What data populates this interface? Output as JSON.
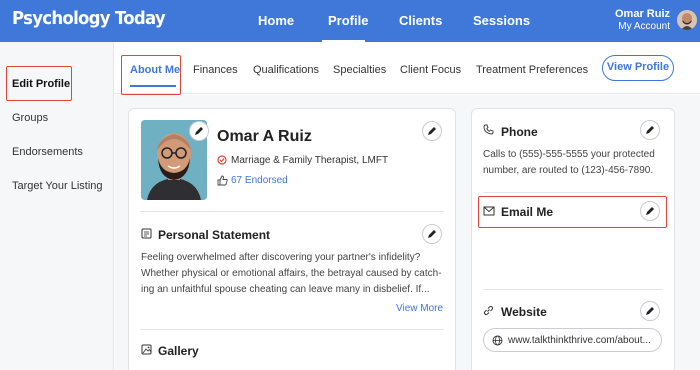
{
  "header": {
    "logo": "Psychology Today",
    "nav": [
      "Home",
      "Profile",
      "Clients",
      "Sessions"
    ],
    "active_nav": "Profile",
    "user_name": "Omar Ruiz",
    "account_label": "My Account"
  },
  "sidebar": {
    "items": [
      {
        "label": "Edit Profile",
        "active": true
      },
      {
        "label": "Groups"
      },
      {
        "label": "Endorsements"
      },
      {
        "label": "Target Your Listing"
      }
    ]
  },
  "tabs": {
    "items": [
      "About Me",
      "Finances",
      "Qualifications",
      "Specialties",
      "Client Focus",
      "Treatment Preferences"
    ],
    "active": "About Me",
    "view_profile": "View Profile"
  },
  "profile": {
    "name": "Omar A Ruiz",
    "profession": "Marriage & Family Therapist, LMFT",
    "endorsed": "67 Endorsed"
  },
  "personal_statement": {
    "title": "Personal Statement",
    "lines": [
      "Feeling overwhelmed after discovering your partner's infidelity?",
      "Whether physical or emotional affairs, the betrayal caused by catch-",
      "ing an unfaithful spouse cheating can leave many in disbelief. If..."
    ],
    "more": "View More"
  },
  "gallery": {
    "title": "Gallery"
  },
  "phone": {
    "title": "Phone",
    "lines": [
      "Calls to (555)-555-5555 your protected",
      "number, are routed to (123)-456-7890."
    ]
  },
  "email": {
    "title": "Email Me"
  },
  "website": {
    "title": "Website",
    "url": "www.talkthinkthrive.com/about..."
  },
  "colors": {
    "brand": "#3f78d9",
    "highlight": "#e0463b"
  }
}
